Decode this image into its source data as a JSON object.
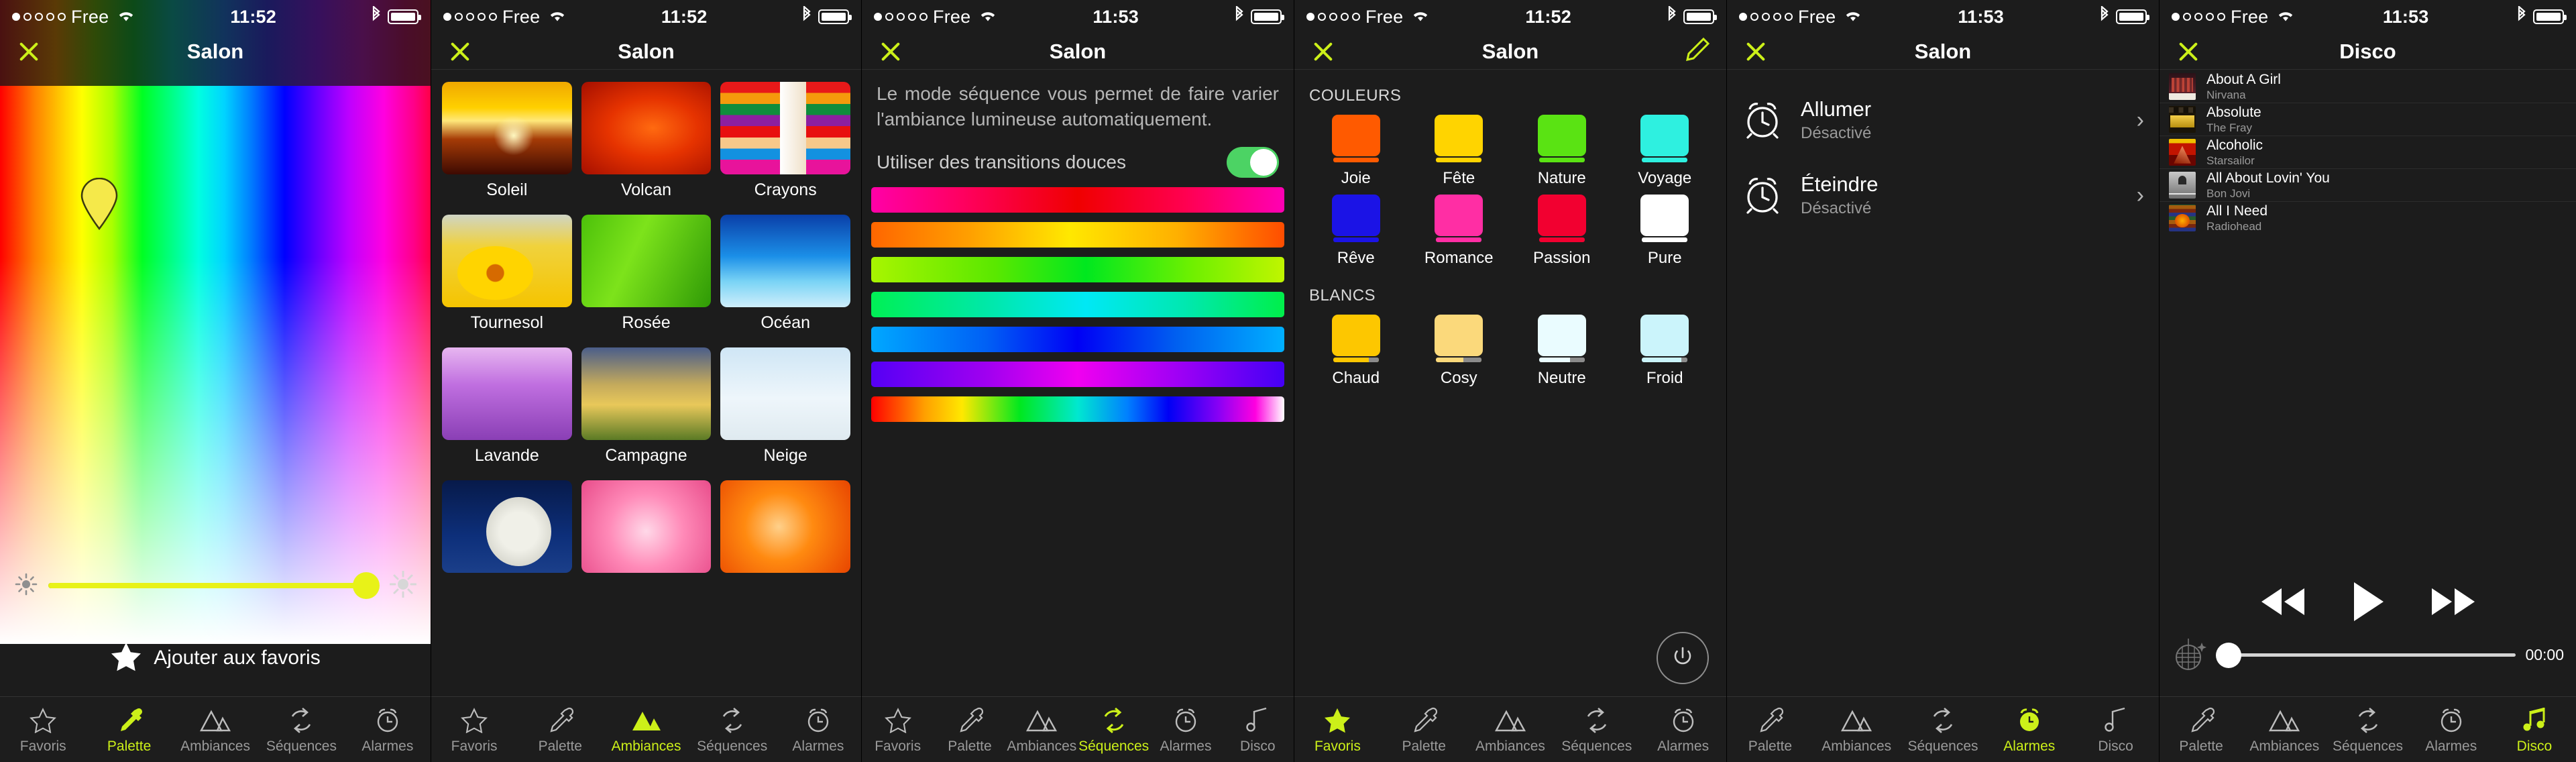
{
  "status": {
    "carrier": "Free",
    "signal_dots_filled": 1,
    "signal_dots_total": 5,
    "time_1": "11:52",
    "time_2": "11:52",
    "time_3": "11:53",
    "time_4": "11:52",
    "time_5": "11:53",
    "time_6": "11:53"
  },
  "accent": "#ccf019",
  "tabs_labels": {
    "favoris": "Favoris",
    "palette": "Palette",
    "ambiances": "Ambiances",
    "sequences": "Séquences",
    "alarmes": "Alarmes",
    "disco": "Disco"
  },
  "screen1": {
    "title": "Salon",
    "favorite_label": "Ajouter aux favoris",
    "brightness_percent": 93,
    "tabs": [
      {
        "label": "Favoris",
        "icon": "star-icon",
        "active": false
      },
      {
        "label": "Palette",
        "icon": "eyedropper-icon",
        "active": true
      },
      {
        "label": "Ambiances",
        "icon": "mountains-icon",
        "active": false
      },
      {
        "label": "Séquences",
        "icon": "refresh-cycle-icon",
        "active": false
      },
      {
        "label": "Alarmes",
        "icon": "alarm-clock-icon",
        "active": false
      }
    ]
  },
  "screen2": {
    "title": "Salon",
    "ambiances": [
      {
        "label": "Soleil"
      },
      {
        "label": "Volcan"
      },
      {
        "label": "Crayons"
      },
      {
        "label": "Tournesol"
      },
      {
        "label": "Rosée"
      },
      {
        "label": "Océan"
      },
      {
        "label": "Lavande"
      },
      {
        "label": "Campagne"
      },
      {
        "label": "Neige"
      }
    ],
    "tabs": [
      {
        "label": "Favoris",
        "icon": "star-icon",
        "active": false
      },
      {
        "label": "Palette",
        "icon": "eyedropper-icon",
        "active": false
      },
      {
        "label": "Ambiances",
        "icon": "mountains-icon",
        "active": true
      },
      {
        "label": "Séquences",
        "icon": "refresh-cycle-icon",
        "active": false
      },
      {
        "label": "Alarmes",
        "icon": "alarm-clock-icon",
        "active": false
      }
    ]
  },
  "screen3": {
    "title": "Salon",
    "description": "Le mode séquence vous permet de faire varier l'ambiance lumineuse automatiquement.",
    "toggle_label": "Utiliser des transitions douces",
    "toggle_on": true,
    "sequences": [
      {
        "name": "pink-red"
      },
      {
        "name": "orange-yellow"
      },
      {
        "name": "lime-green"
      },
      {
        "name": "green-cyan"
      },
      {
        "name": "blue-deep"
      },
      {
        "name": "violet-magenta"
      },
      {
        "name": "full-rainbow"
      }
    ],
    "tabs": [
      {
        "label": "Favoris",
        "icon": "star-icon",
        "active": false
      },
      {
        "label": "Palette",
        "icon": "eyedropper-icon",
        "active": false
      },
      {
        "label": "Ambiances",
        "icon": "mountains-icon",
        "active": false
      },
      {
        "label": "Séquences",
        "icon": "refresh-cycle-icon",
        "active": true
      },
      {
        "label": "Alarmes",
        "icon": "alarm-clock-icon",
        "active": false
      },
      {
        "label": "Disco",
        "icon": "music-note-icon",
        "active": false
      }
    ]
  },
  "screen4": {
    "title": "Salon",
    "section_colors": "COULEURS",
    "section_whites": "BLANCS",
    "colors": [
      {
        "label": "Joie",
        "hex": "#ff5a00"
      },
      {
        "label": "Fête",
        "hex": "#ffd400"
      },
      {
        "label": "Nature",
        "hex": "#5ae313"
      },
      {
        "label": "Voyage",
        "hex": "#2ef0e0"
      },
      {
        "label": "Rêve",
        "hex": "#1b13e6"
      },
      {
        "label": "Romance",
        "hex": "#ff2ea4"
      },
      {
        "label": "Passion",
        "hex": "#f20030"
      },
      {
        "label": "Pure",
        "hex": "#ffffff"
      }
    ],
    "whites": [
      {
        "label": "Chaud",
        "hex": "#fdc700"
      },
      {
        "label": "Cosy",
        "hex": "#fbd97b"
      },
      {
        "label": "Neutre",
        "hex": "#eafcff"
      },
      {
        "label": "Froid",
        "hex": "#cbf4fb"
      }
    ],
    "power_icon": "power-icon",
    "tabs": [
      {
        "label": "Favoris",
        "icon": "star-icon",
        "active": true
      },
      {
        "label": "Palette",
        "icon": "eyedropper-icon",
        "active": false
      },
      {
        "label": "Ambiances",
        "icon": "mountains-icon",
        "active": false
      },
      {
        "label": "Séquences",
        "icon": "refresh-cycle-icon",
        "active": false
      },
      {
        "label": "Alarmes",
        "icon": "alarm-clock-icon",
        "active": false
      }
    ]
  },
  "screen5": {
    "title": "Salon",
    "alarms": [
      {
        "title": "Allumer",
        "status": "Désactivé"
      },
      {
        "title": "Éteindre",
        "status": "Désactivé"
      }
    ],
    "tabs": [
      {
        "label": "Palette",
        "icon": "eyedropper-icon",
        "active": false
      },
      {
        "label": "Ambiances",
        "icon": "mountains-icon",
        "active": false
      },
      {
        "label": "Séquences",
        "icon": "refresh-cycle-icon",
        "active": false
      },
      {
        "label": "Alarmes",
        "icon": "alarm-clock-icon",
        "active": true
      },
      {
        "label": "Disco",
        "icon": "music-note-icon",
        "active": false
      }
    ]
  },
  "screen6": {
    "title": "Disco",
    "songs": [
      {
        "title": "About A Girl",
        "artist": "Nirvana"
      },
      {
        "title": "Absolute",
        "artist": "The Fray"
      },
      {
        "title": "Alcoholic",
        "artist": "Starsailor"
      },
      {
        "title": "All About Lovin' You",
        "artist": "Bon Jovi"
      },
      {
        "title": "All I Need",
        "artist": "Radiohead"
      }
    ],
    "player": {
      "prev_icon": "rewind-icon",
      "play_icon": "play-icon",
      "next_icon": "fast-forward-icon",
      "disco_ball_icon": "disco-ball-icon",
      "elapsed": "00:00",
      "seek_percent": 0
    },
    "tabs": [
      {
        "label": "Palette",
        "icon": "eyedropper-icon",
        "active": false
      },
      {
        "label": "Ambiances",
        "icon": "mountains-icon",
        "active": false
      },
      {
        "label": "Séquences",
        "icon": "refresh-cycle-icon",
        "active": false
      },
      {
        "label": "Alarmes",
        "icon": "alarm-clock-icon",
        "active": false
      },
      {
        "label": "Disco",
        "icon": "music-note-icon",
        "active": true
      }
    ]
  }
}
